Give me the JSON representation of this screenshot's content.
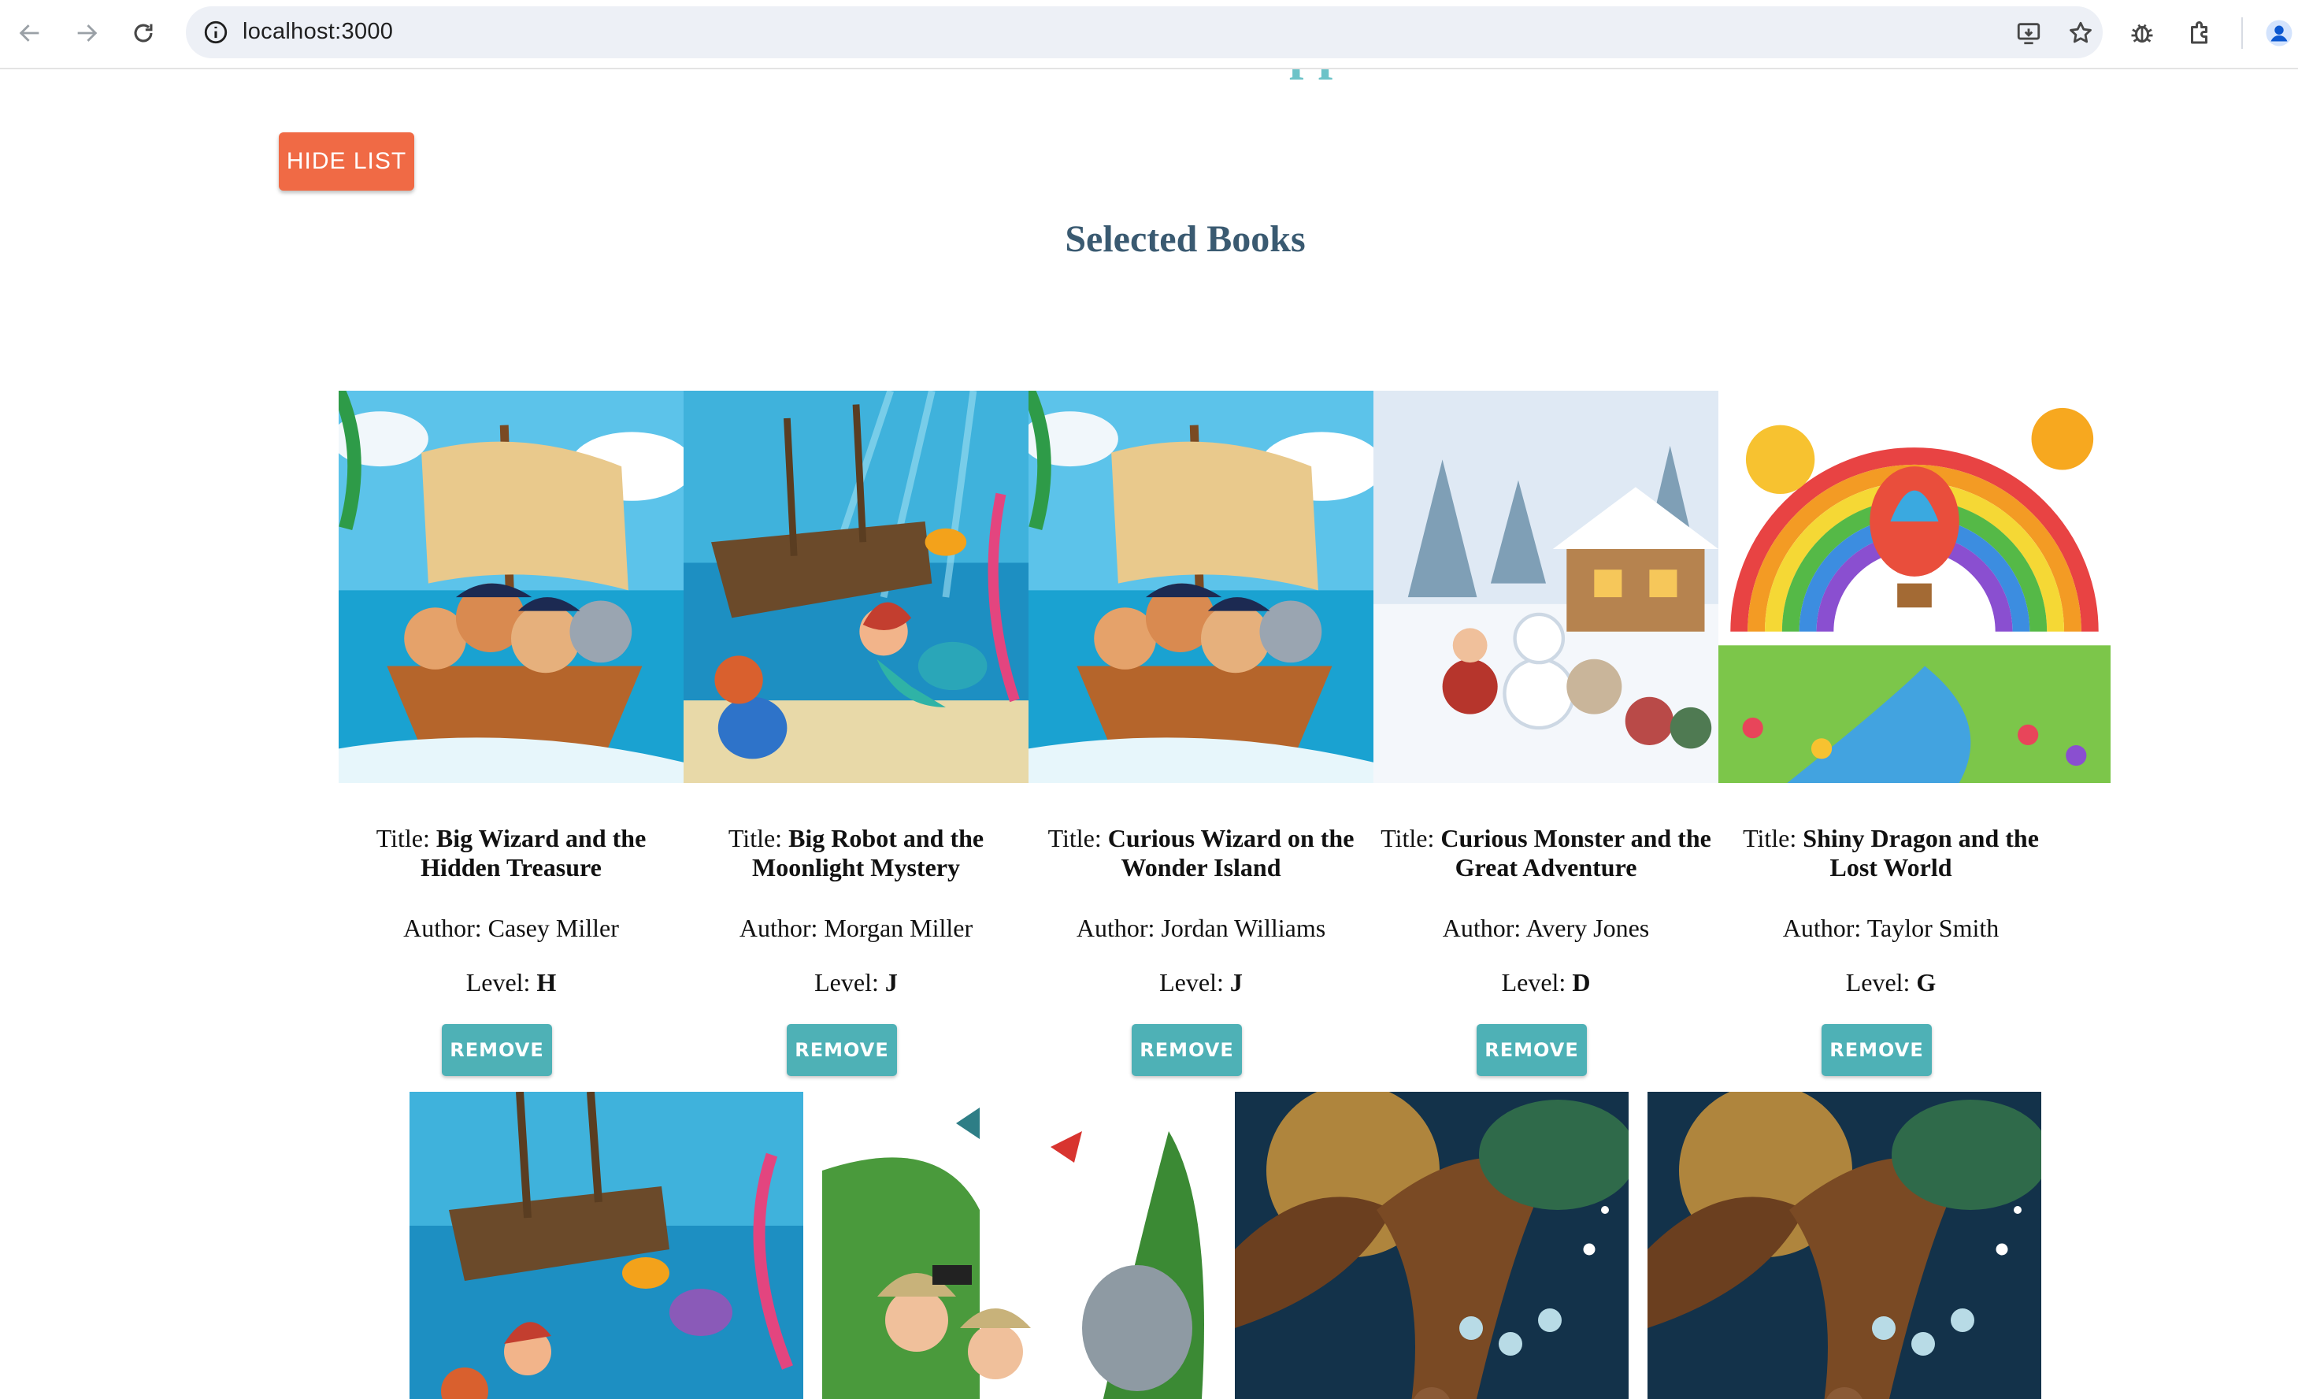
{
  "browser": {
    "url": "localhost:3000",
    "icons": [
      "back-icon",
      "forward-icon",
      "reload-icon",
      "site-info-icon",
      "install-app-icon",
      "bookmark-star-icon",
      "extension-bug-icon",
      "extensions-puzzle-icon",
      "profile-icon"
    ]
  },
  "app": {
    "title": "Ello Book App",
    "hide_list_label": "HIDE LIST",
    "section_title": "Selected Books"
  },
  "labels": {
    "title_prefix": "Title: ",
    "author_prefix": "Author: ",
    "level_prefix": "Level: ",
    "remove": "REMOVE"
  },
  "selected_books": [
    {
      "title": "Big Wizard and the Hidden Treasure",
      "author": "Casey Miller",
      "level": "H",
      "cover": "pirate-ship-cover"
    },
    {
      "title": "Big Robot and the Moonlight Mystery",
      "author": "Morgan Miller",
      "level": "J",
      "cover": "underwater-shipwreck-cover"
    },
    {
      "title": "Curious Wizard on the Wonder Island",
      "author": "Jordan Williams",
      "level": "J",
      "cover": "pirate-ship-cover"
    },
    {
      "title": "Curious Monster and the Great Adventure",
      "author": "Avery Jones",
      "level": "D",
      "cover": "snowy-village-cover"
    },
    {
      "title": "Shiny Dragon and the Lost World",
      "author": "Taylor Smith",
      "level": "G",
      "cover": "rainbow-balloon-cover"
    }
  ],
  "book_list_covers": [
    "underwater-shipwreck-cover",
    "jungle-safari-cover",
    "enchanted-forest-cover",
    "enchanted-forest-cover"
  ],
  "colors": {
    "title_teal": "#6cc3c8",
    "hide_button": "#f06a45",
    "section_title": "#3a5a71",
    "remove_button": "#4eb1b6"
  }
}
